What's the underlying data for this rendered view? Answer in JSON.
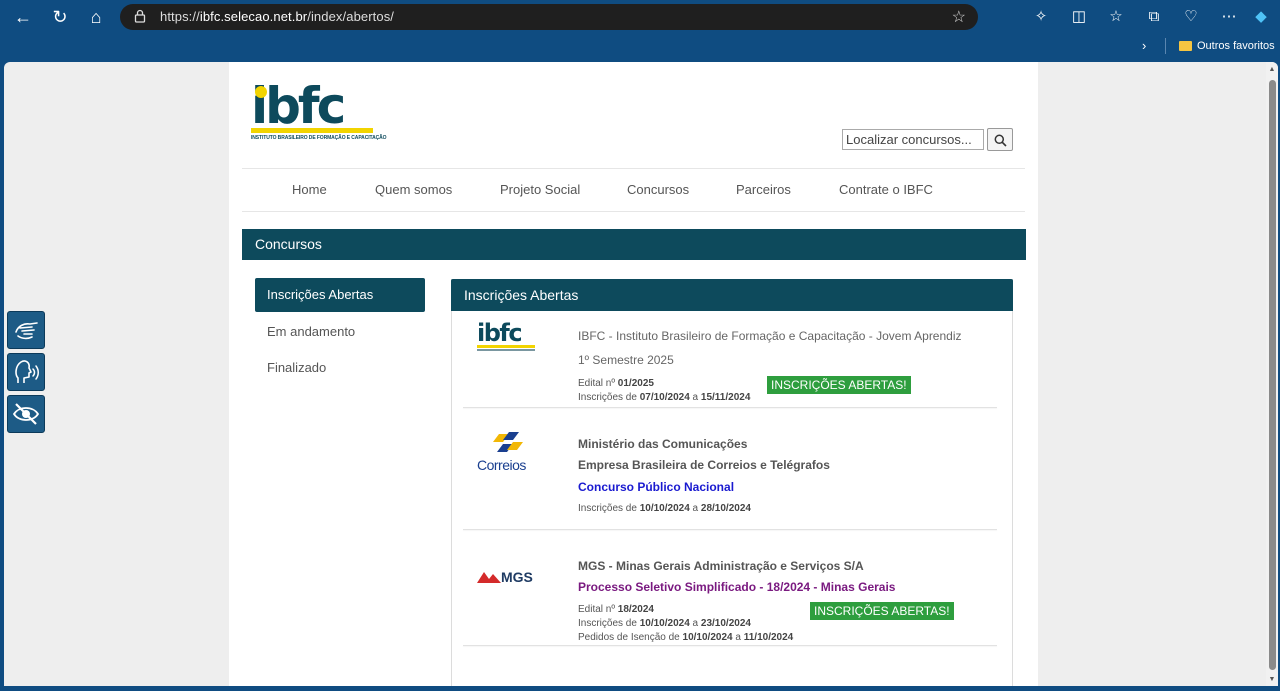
{
  "browser": {
    "url_scheme": "https://",
    "url_host": "ibfc.selecao.net.br",
    "url_path": "/index/abertos/",
    "favorites_folder": "Outros favoritos"
  },
  "site": {
    "logo_text": "ibfc",
    "logo_subtitle": "INSTITUTO BRASILEIRO DE FORMAÇÃO E CAPACITAÇÃO",
    "search_placeholder": "Localizar concursos...",
    "nav": [
      "Home",
      "Quem somos",
      "Projeto Social",
      "Concursos",
      "Parceiros",
      "Contrate o IBFC"
    ],
    "section_title": "Concursos"
  },
  "sidebar": {
    "items": [
      "Inscrições Abertas",
      "Em andamento",
      "Finalizado"
    ]
  },
  "listing": {
    "header": "Inscrições Abertas",
    "entries": [
      {
        "org": "IBFC - Instituto Brasileiro de Formação e Capacitação - Jovem Aprendiz",
        "subtitle": "1º Semestre 2025",
        "edital_label": "Edital nº",
        "edital": "01/2025",
        "insc_label": "Inscrições de",
        "insc_from": "07/10/2024",
        "connector": "a",
        "insc_to": "15/11/2024",
        "badge": "INSCRIÇÕES ABERTAS!"
      },
      {
        "org": "Ministério das Comunicações",
        "company": "Empresa Brasileira de Correios e Telégrafos",
        "title": "Concurso Público Nacional",
        "logo_word": "Correios",
        "insc_label": "Inscrições de",
        "insc_from": "10/10/2024",
        "connector": "a",
        "insc_to": "28/10/2024"
      },
      {
        "org": "MGS - Minas Gerais Administração e Serviços S/A",
        "title": "Processo Seletivo Simplificado - 18/2024 - Minas Gerais",
        "logo_word": "MGS",
        "edital_label": "Edital nº",
        "edital": "18/2024",
        "insc_label": "Inscrições de",
        "insc_from": "10/10/2024",
        "connector": "a",
        "insc_to": "23/10/2024",
        "isencao_label": "Pedidos de Isenção de",
        "isencao_from": "10/10/2024",
        "isencao_to": "11/10/2024",
        "badge": "INSCRIÇÕES ABERTAS!"
      }
    ]
  },
  "colors": {
    "brand": "#0d4a5c",
    "brand_yellow": "#f2d400",
    "badge_green": "#2e9e3e",
    "browser_frame": "#0f4c81"
  },
  "icons": {
    "a11y": [
      "sign-language-icon",
      "voice-reader-icon",
      "high-contrast-icon"
    ]
  }
}
